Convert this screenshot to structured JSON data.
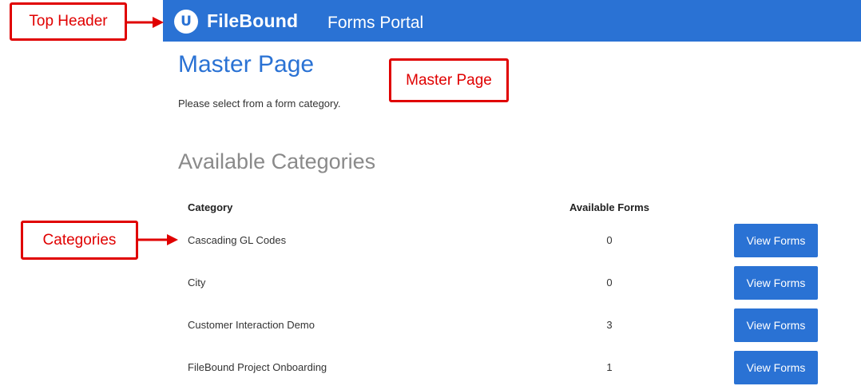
{
  "header": {
    "logo_letter": "U",
    "brand": "FileBound",
    "portal": "Forms Portal"
  },
  "page": {
    "title": "Master Page",
    "intro": "Please select from a form category."
  },
  "categories": {
    "title": "Available Categories",
    "headers": {
      "category": "Category",
      "forms": "Available Forms"
    },
    "rows": [
      {
        "name": "Cascading GL Codes",
        "count": "0",
        "button": "View Forms"
      },
      {
        "name": "City",
        "count": "0",
        "button": "View Forms"
      },
      {
        "name": "Customer Interaction Demo",
        "count": "3",
        "button": "View Forms"
      },
      {
        "name": "FileBound Project Onboarding",
        "count": "1",
        "button": "View Forms"
      }
    ]
  },
  "annotations": {
    "top_header": "Top Header",
    "master_page": "Master Page",
    "categories": "Categories"
  },
  "colors": {
    "brand_blue": "#2a72d4",
    "annotation_red": "#e00000",
    "section_gray": "#8a8a8a"
  }
}
